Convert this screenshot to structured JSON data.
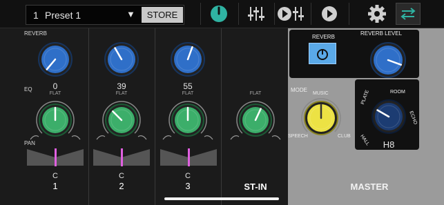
{
  "topbar": {
    "preset_number": "1",
    "preset_name": "Preset 1",
    "dropdown_symbol": "▼",
    "store_label": "STORE"
  },
  "channels": [
    {
      "name": "C",
      "number": "1",
      "reverb_label": "REVERB",
      "eq_label": "EQ",
      "pan_label": "PAN",
      "reverb_value": "0",
      "flat_label": "FLAT"
    },
    {
      "name": "C",
      "number": "2",
      "reverb_value": "39",
      "flat_label": "FLAT"
    },
    {
      "name": "C",
      "number": "3",
      "reverb_value": "55",
      "flat_label": "FLAT"
    }
  ],
  "stereo_in": {
    "name": "ST-IN",
    "flat_label": "FLAT"
  },
  "master": {
    "title": "MASTER",
    "reverb_label": "REVERB",
    "reverb_level_label": "REVERB LEVEL",
    "reverb_level_value": "89",
    "mode_label": "MODE",
    "mode_options": {
      "music": "MUSIC",
      "speech": "SPEECH",
      "club": "CLUB"
    },
    "type_options": {
      "room": "ROOM",
      "plate": "PLATE",
      "echo": "ECHO",
      "hall": "HALL"
    },
    "type_value": "H8"
  },
  "colors": {
    "accent_teal": "#2fb3a2",
    "eq_green": "#3cae6a",
    "reverb_blue": "#2f6fc8",
    "mode_yellow": "#ece244",
    "pan_pink": "#e060e0"
  }
}
